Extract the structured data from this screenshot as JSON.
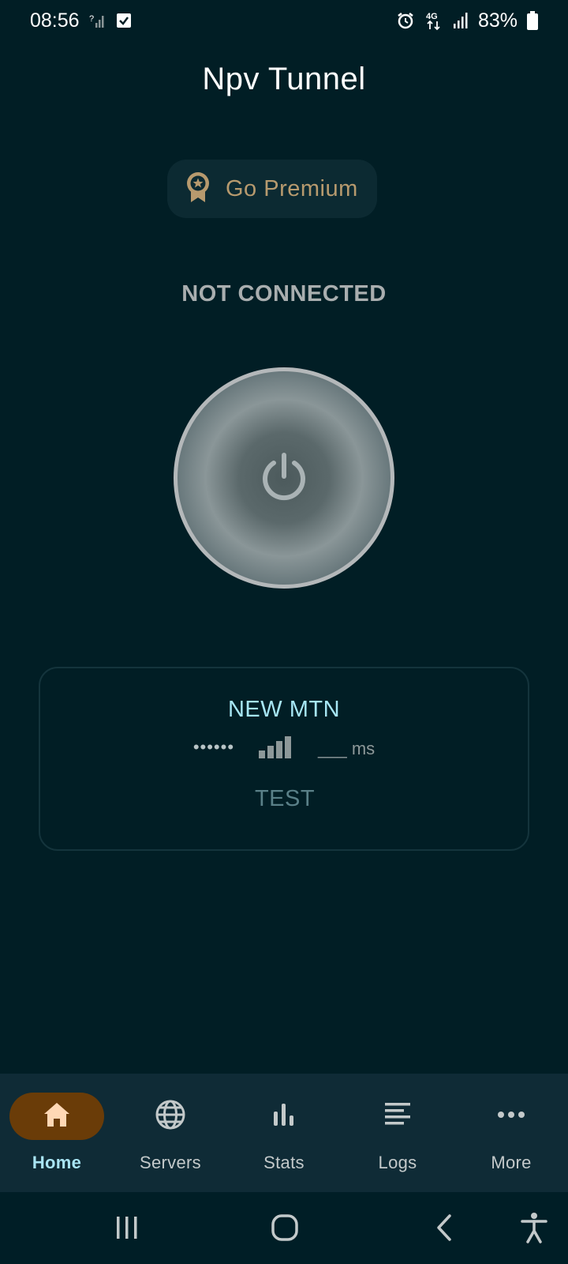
{
  "status_bar": {
    "time": "08:56",
    "battery_percent": "83%",
    "network_type": "4G",
    "icons_left": [
      "no-signal-icon",
      "checkbox-notification-icon"
    ],
    "icons_right": [
      "alarm-icon",
      "4g-data-icon",
      "signal-icon",
      "battery-icon"
    ]
  },
  "app": {
    "title": "Npv Tunnel"
  },
  "premium": {
    "label": "Go Premium",
    "icon": "award-ribbon-icon",
    "color": "#b79a6e"
  },
  "connection": {
    "status": "NOT CONNECTED",
    "power_icon": "power-icon"
  },
  "server_card": {
    "name": "NEW MTN",
    "ping_dots": "••••••",
    "signal_bars": 4,
    "ping_value": "___ ms",
    "test_label": "TEST"
  },
  "bottom_nav": {
    "items": [
      {
        "label": "Home",
        "icon": "home-icon",
        "active": true
      },
      {
        "label": "Servers",
        "icon": "globe-icon",
        "active": false
      },
      {
        "label": "Stats",
        "icon": "bar-chart-icon",
        "active": false
      },
      {
        "label": "Logs",
        "icon": "list-lines-icon",
        "active": false
      },
      {
        "label": "More",
        "icon": "more-dots-icon",
        "active": false
      }
    ],
    "active_color": "#6a3c08"
  },
  "system_nav": {
    "buttons": [
      "recents-icon",
      "home-circle-icon",
      "back-icon",
      "accessibility-icon"
    ]
  }
}
